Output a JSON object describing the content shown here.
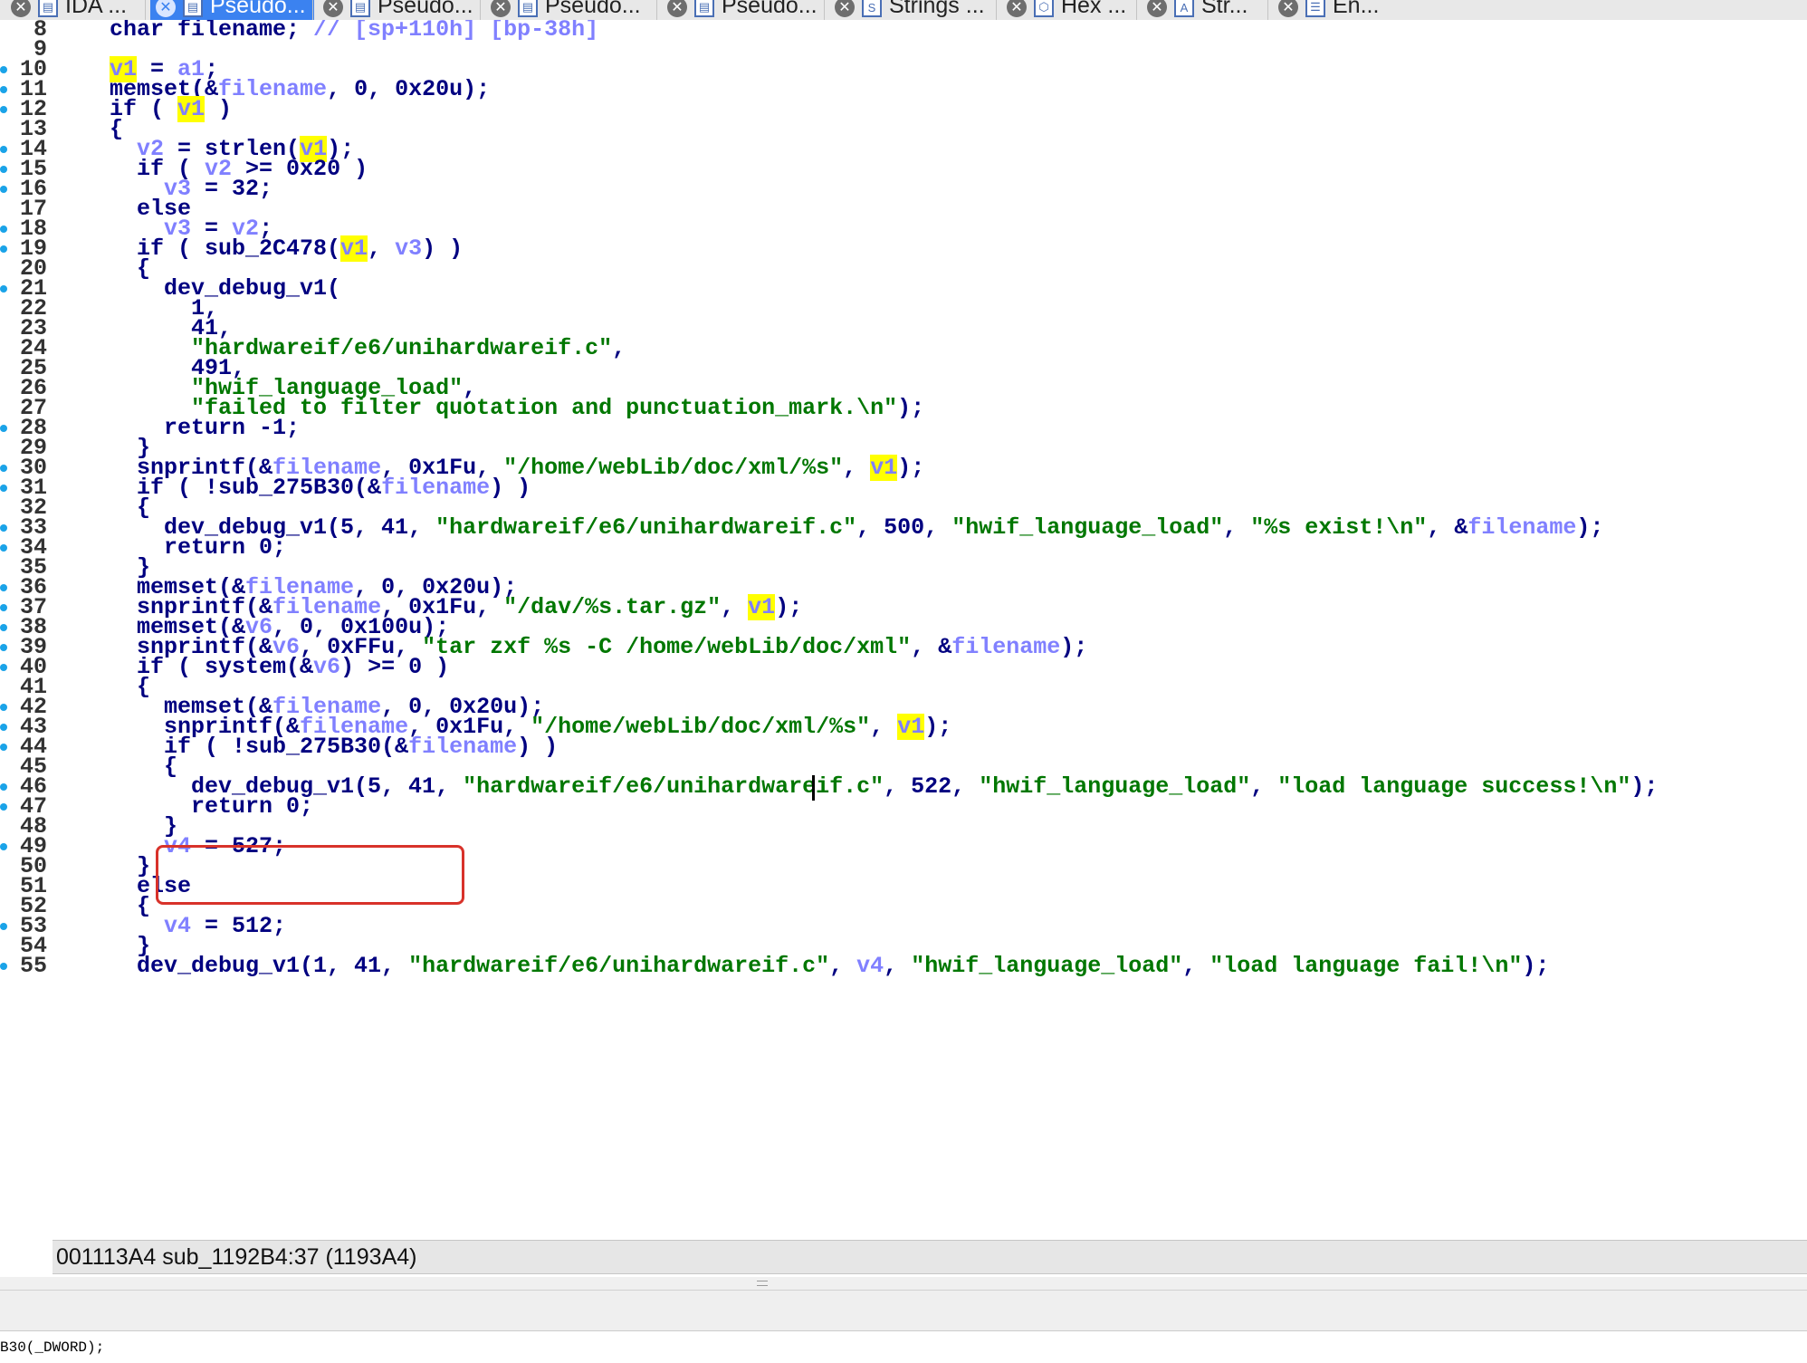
{
  "tabs": [
    {
      "label": "IDA ...",
      "active": false
    },
    {
      "label": "Pseudo...",
      "active": true
    },
    {
      "label": "Pseudo...",
      "active": false
    },
    {
      "label": "Pseudo...",
      "active": false
    },
    {
      "label": "Pseudo...",
      "active": false
    },
    {
      "label": "Strings ...",
      "active": false
    },
    {
      "label": "Hex ...",
      "active": false
    },
    {
      "label": "Str...",
      "active": false
    },
    {
      "label": "En...",
      "active": false
    }
  ],
  "code_lines": [
    {
      "n": "8",
      "dot": false,
      "segs": [
        [
          "p",
          "  char filename; "
        ],
        [
          "c",
          "// [sp+110h] [bp-38h]"
        ]
      ]
    },
    {
      "n": "9",
      "dot": false,
      "segs": []
    },
    {
      "n": "10",
      "dot": true,
      "segs": [
        [
          "p",
          "  "
        ],
        [
          "hl",
          "v1"
        ],
        [
          "p",
          " = "
        ],
        [
          "v",
          "a1"
        ],
        [
          "p",
          ";"
        ]
      ]
    },
    {
      "n": "11",
      "dot": true,
      "segs": [
        [
          "p",
          "  memset(&"
        ],
        [
          "v",
          "filename"
        ],
        [
          "p",
          ", 0, 0x20u);"
        ]
      ]
    },
    {
      "n": "12",
      "dot": true,
      "segs": [
        [
          "p",
          "  if ( "
        ],
        [
          "hl",
          "v1"
        ],
        [
          "p",
          " )"
        ]
      ]
    },
    {
      "n": "13",
      "dot": false,
      "segs": [
        [
          "p",
          "  {"
        ]
      ]
    },
    {
      "n": "14",
      "dot": true,
      "segs": [
        [
          "p",
          "    "
        ],
        [
          "v",
          "v2"
        ],
        [
          "p",
          " = strlen("
        ],
        [
          "hl",
          "v1"
        ],
        [
          "p",
          ");"
        ]
      ]
    },
    {
      "n": "15",
      "dot": true,
      "segs": [
        [
          "p",
          "    if ( "
        ],
        [
          "v",
          "v2"
        ],
        [
          "p",
          " >= 0x20 )"
        ]
      ]
    },
    {
      "n": "16",
      "dot": true,
      "segs": [
        [
          "p",
          "      "
        ],
        [
          "v",
          "v3"
        ],
        [
          "p",
          " = 32;"
        ]
      ]
    },
    {
      "n": "17",
      "dot": false,
      "segs": [
        [
          "p",
          "    else"
        ]
      ]
    },
    {
      "n": "18",
      "dot": true,
      "segs": [
        [
          "p",
          "      "
        ],
        [
          "v",
          "v3"
        ],
        [
          "p",
          " = "
        ],
        [
          "v",
          "v2"
        ],
        [
          "p",
          ";"
        ]
      ]
    },
    {
      "n": "19",
      "dot": true,
      "segs": [
        [
          "p",
          "    if ( sub_2C478("
        ],
        [
          "hl",
          "v1"
        ],
        [
          "p",
          ", "
        ],
        [
          "v",
          "v3"
        ],
        [
          "p",
          ") )"
        ]
      ]
    },
    {
      "n": "20",
      "dot": false,
      "segs": [
        [
          "p",
          "    {"
        ]
      ]
    },
    {
      "n": "21",
      "dot": true,
      "segs": [
        [
          "p",
          "      dev_debug_v1("
        ]
      ]
    },
    {
      "n": "22",
      "dot": false,
      "segs": [
        [
          "p",
          "        1,"
        ]
      ]
    },
    {
      "n": "23",
      "dot": false,
      "segs": [
        [
          "p",
          "        41,"
        ]
      ]
    },
    {
      "n": "24",
      "dot": false,
      "segs": [
        [
          "p",
          "        "
        ],
        [
          "s",
          "\"hardwareif/e6/unihardwareif.c\""
        ],
        [
          "p",
          ","
        ]
      ]
    },
    {
      "n": "25",
      "dot": false,
      "segs": [
        [
          "p",
          "        491,"
        ]
      ]
    },
    {
      "n": "26",
      "dot": false,
      "segs": [
        [
          "p",
          "        "
        ],
        [
          "s",
          "\"hwif_language_load\""
        ],
        [
          "p",
          ","
        ]
      ]
    },
    {
      "n": "27",
      "dot": false,
      "segs": [
        [
          "p",
          "        "
        ],
        [
          "s",
          "\"failed to filter quotation and punctuation_mark.\\n\""
        ],
        [
          "p",
          ");"
        ]
      ]
    },
    {
      "n": "28",
      "dot": true,
      "segs": [
        [
          "p",
          "      return -1;"
        ]
      ]
    },
    {
      "n": "29",
      "dot": false,
      "segs": [
        [
          "p",
          "    }"
        ]
      ]
    },
    {
      "n": "30",
      "dot": true,
      "segs": [
        [
          "p",
          "    snprintf(&"
        ],
        [
          "v",
          "filename"
        ],
        [
          "p",
          ", 0x1Fu, "
        ],
        [
          "s",
          "\"/home/webLib/doc/xml/%s\""
        ],
        [
          "p",
          ", "
        ],
        [
          "hl",
          "v1"
        ],
        [
          "p",
          ");"
        ]
      ]
    },
    {
      "n": "31",
      "dot": true,
      "segs": [
        [
          "p",
          "    if ( !sub_275B30(&"
        ],
        [
          "v",
          "filename"
        ],
        [
          "p",
          ") )"
        ]
      ]
    },
    {
      "n": "32",
      "dot": false,
      "segs": [
        [
          "p",
          "    {"
        ]
      ]
    },
    {
      "n": "33",
      "dot": true,
      "segs": [
        [
          "p",
          "      dev_debug_v1(5, 41, "
        ],
        [
          "s",
          "\"hardwareif/e6/unihardwareif.c\""
        ],
        [
          "p",
          ", 500, "
        ],
        [
          "s",
          "\"hwif_language_load\""
        ],
        [
          "p",
          ", "
        ],
        [
          "s",
          "\"%s exist!\\n\""
        ],
        [
          "p",
          ", &"
        ],
        [
          "v",
          "filename"
        ],
        [
          "p",
          ");"
        ]
      ]
    },
    {
      "n": "34",
      "dot": true,
      "segs": [
        [
          "p",
          "      return 0;"
        ]
      ]
    },
    {
      "n": "35",
      "dot": false,
      "segs": [
        [
          "p",
          "    }"
        ]
      ]
    },
    {
      "n": "36",
      "dot": true,
      "segs": [
        [
          "p",
          "    memset(&"
        ],
        [
          "v",
          "filename"
        ],
        [
          "p",
          ", 0, 0x20u);"
        ]
      ]
    },
    {
      "n": "37",
      "dot": true,
      "segs": [
        [
          "p",
          "    snprintf(&"
        ],
        [
          "v",
          "filename"
        ],
        [
          "p",
          ", 0x1Fu, "
        ],
        [
          "s",
          "\"/dav/%s.tar.gz\""
        ],
        [
          "p",
          ", "
        ],
        [
          "hl",
          "v1"
        ],
        [
          "p",
          ");"
        ]
      ]
    },
    {
      "n": "38",
      "dot": true,
      "segs": [
        [
          "p",
          "    memset(&"
        ],
        [
          "v",
          "v6"
        ],
        [
          "p",
          ", 0, 0x100u);"
        ]
      ]
    },
    {
      "n": "39",
      "dot": true,
      "segs": [
        [
          "p",
          "    snprintf(&"
        ],
        [
          "v",
          "v6"
        ],
        [
          "p",
          ", 0xFFu, "
        ],
        [
          "s",
          "\"tar zxf %s -C /home/webLib/doc/xml\""
        ],
        [
          "p",
          ", &"
        ],
        [
          "v",
          "filename"
        ],
        [
          "p",
          ");"
        ]
      ]
    },
    {
      "n": "40",
      "dot": true,
      "segs": [
        [
          "p",
          "    if ( system(&"
        ],
        [
          "v",
          "v6"
        ],
        [
          "p",
          ") >= 0 )"
        ]
      ]
    },
    {
      "n": "41",
      "dot": false,
      "segs": [
        [
          "p",
          "    {"
        ]
      ]
    },
    {
      "n": "42",
      "dot": true,
      "segs": [
        [
          "p",
          "      memset(&"
        ],
        [
          "v",
          "filename"
        ],
        [
          "p",
          ", 0, 0x20u);"
        ]
      ]
    },
    {
      "n": "43",
      "dot": true,
      "segs": [
        [
          "p",
          "      snprintf(&"
        ],
        [
          "v",
          "filename"
        ],
        [
          "p",
          ", 0x1Fu, "
        ],
        [
          "s",
          "\"/home/webLib/doc/xml/%s\""
        ],
        [
          "p",
          ", "
        ],
        [
          "hl",
          "v1"
        ],
        [
          "p",
          ");"
        ]
      ]
    },
    {
      "n": "44",
      "dot": true,
      "segs": [
        [
          "p",
          "      if ( !sub_275B30(&"
        ],
        [
          "v",
          "filename"
        ],
        [
          "p",
          ") )"
        ]
      ]
    },
    {
      "n": "45",
      "dot": false,
      "segs": [
        [
          "p",
          "      {"
        ]
      ]
    },
    {
      "n": "46",
      "dot": true,
      "segs": [
        [
          "p",
          "        dev_debug_v1(5, 41, "
        ],
        [
          "s",
          "\"hardwareif/e6/unihardwareif.c\""
        ],
        [
          "p",
          ", 522, "
        ],
        [
          "s",
          "\"hwif_language_load\""
        ],
        [
          "p",
          ", "
        ],
        [
          "s",
          "\"load language success!\\n\""
        ],
        [
          "p",
          ");"
        ]
      ]
    },
    {
      "n": "47",
      "dot": true,
      "segs": [
        [
          "p",
          "        return 0;"
        ]
      ]
    },
    {
      "n": "48",
      "dot": false,
      "segs": [
        [
          "p",
          "      }"
        ]
      ]
    },
    {
      "n": "49",
      "dot": true,
      "segs": [
        [
          "p",
          "      "
        ],
        [
          "v",
          "v4"
        ],
        [
          "p",
          " = 527;"
        ]
      ]
    },
    {
      "n": "50",
      "dot": false,
      "segs": [
        [
          "p",
          "    }"
        ]
      ]
    },
    {
      "n": "51",
      "dot": false,
      "segs": [
        [
          "p",
          "    else"
        ]
      ]
    },
    {
      "n": "52",
      "dot": false,
      "segs": [
        [
          "p",
          "    {"
        ]
      ]
    },
    {
      "n": "53",
      "dot": true,
      "segs": [
        [
          "p",
          "      "
        ],
        [
          "v",
          "v4"
        ],
        [
          "p",
          " = 512;"
        ]
      ]
    },
    {
      "n": "54",
      "dot": false,
      "segs": [
        [
          "p",
          "    }"
        ]
      ]
    },
    {
      "n": "55",
      "dot": true,
      "segs": [
        [
          "p",
          "    dev_debug_v1(1, 41, "
        ],
        [
          "s",
          "\"hardwareif/e6/unihardwareif.c\""
        ],
        [
          "p",
          ", "
        ],
        [
          "v",
          "v4"
        ],
        [
          "p",
          ", "
        ],
        [
          "s",
          "\"hwif_language_load\""
        ],
        [
          "p",
          ", "
        ],
        [
          "s",
          "\"load language fail!\\n\""
        ],
        [
          "p",
          ");"
        ]
      ]
    }
  ],
  "status": {
    "text": "001113A4  sub_1192B4:37 (1193A4)"
  },
  "output": {
    "line2": "B30(_DWORD);"
  },
  "colors": {
    "keyword": "#000080",
    "variable": "#8080ff",
    "string": "#007700",
    "highlight": "#ffff00",
    "annotation_box": "#d8322a",
    "active_tab": "#3b82f0",
    "breakpoint_dot": "#1aa3e8"
  },
  "icons": [
    "close-icon",
    "pseudocode-tab-icon",
    "strings-tab-icon",
    "hex-view-icon"
  ]
}
